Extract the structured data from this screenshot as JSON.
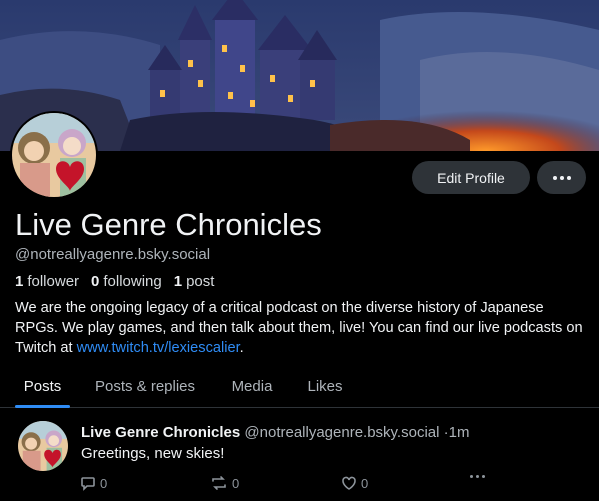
{
  "profile": {
    "display_name": "Live Genre Chronicles",
    "handle": "@notreallyagenre.bsky.social",
    "followers_count": "1",
    "followers_label": "follower",
    "following_count": "0",
    "following_label": "following",
    "posts_count": "1",
    "posts_label": "post",
    "bio_text": "We are the ongoing legacy of a critical podcast on the diverse history of Japanese RPGs. We play games, and then talk about them, live! You can find our live podcasts on Twitch at ",
    "bio_link": "www.twitch.tv/lexiescalier",
    "bio_end": "."
  },
  "actions": {
    "edit_profile_label": "Edit Profile",
    "more_icon": "ellipsis-icon"
  },
  "tabs": [
    {
      "label": "Posts",
      "active": true
    },
    {
      "label": "Posts & replies",
      "active": false
    },
    {
      "label": "Media",
      "active": false
    },
    {
      "label": "Likes",
      "active": false
    }
  ],
  "post": {
    "author": "Live Genre Chronicles",
    "handle": "@notreallyagenre.bsky.social",
    "separator": "·",
    "time": "1m",
    "text": "Greetings, new skies!",
    "reply_count": "0",
    "repost_count": "0",
    "like_count": "0"
  },
  "colors": {
    "background": "#000000",
    "accent": "#2f8cf5",
    "button_bg": "#2e3338",
    "muted_text": "#aeb4ba"
  }
}
